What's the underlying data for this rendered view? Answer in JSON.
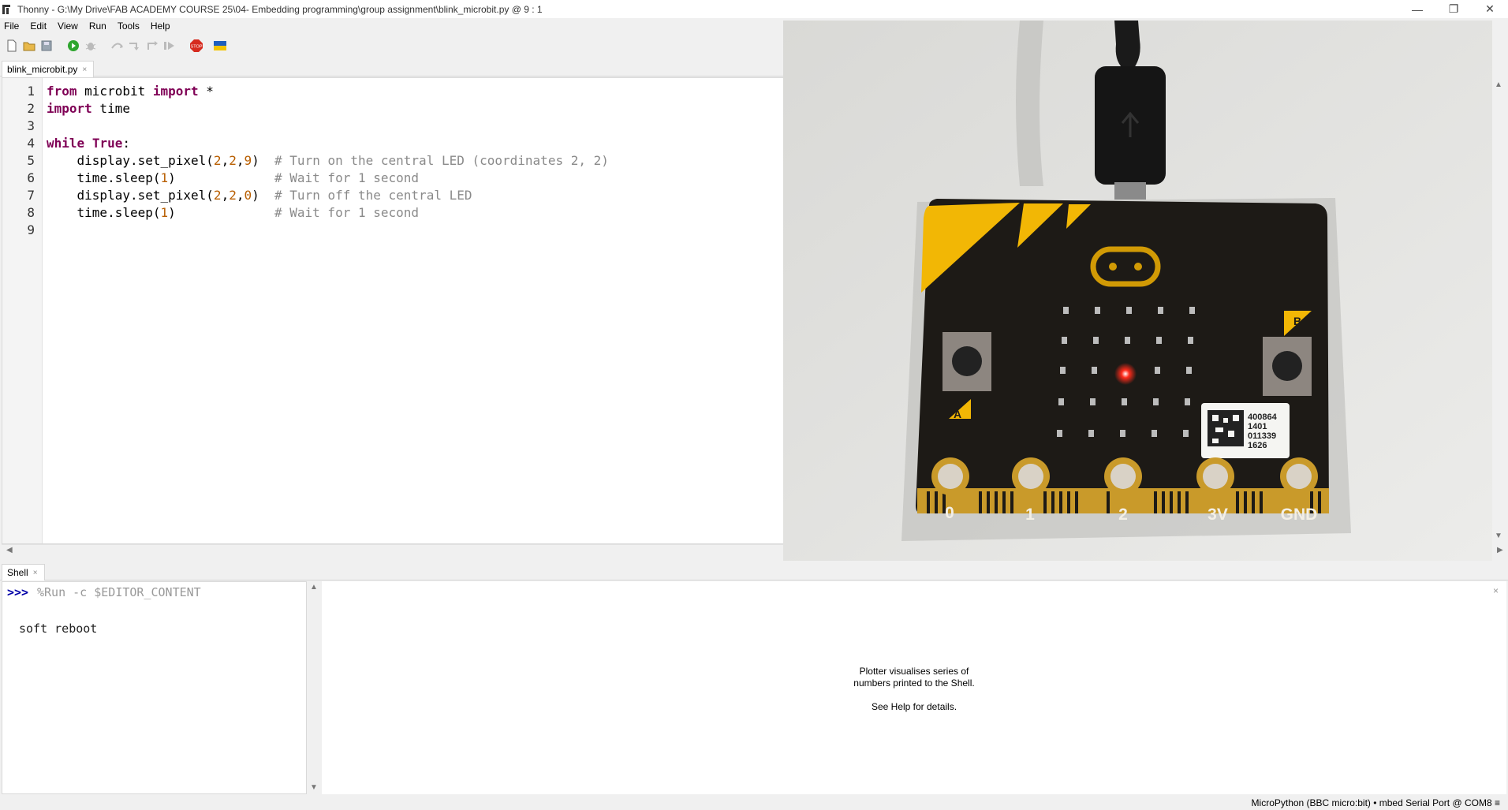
{
  "window": {
    "title": "Thonny  -  G:\\My Drive\\FAB ACADEMY COURSE 25\\04- Embedding programming\\group assignment\\blink_microbit.py  @  9 : 1",
    "minimize": "—",
    "maximize": "❐",
    "close": "✕"
  },
  "menu": [
    "File",
    "Edit",
    "View",
    "Run",
    "Tools",
    "Help"
  ],
  "toolbar": {
    "buttons": [
      "new-file-icon",
      "open-file-icon",
      "save-icon",
      "run-icon",
      "debug-icon",
      "step-over-icon",
      "step-into-icon",
      "step-out-icon",
      "resume-icon",
      "stop-icon",
      "ukraine-flag-icon"
    ],
    "stop_label": "STOP"
  },
  "editor": {
    "tab_label": "blink_microbit.py",
    "tab_close": "×",
    "line_numbers": [
      "1",
      "2",
      "3",
      "4",
      "5",
      "6",
      "7",
      "8",
      "9"
    ],
    "lines": [
      [
        "from",
        " microbit ",
        "import",
        " *"
      ],
      [
        "import",
        " time"
      ],
      [
        ""
      ],
      [
        "while",
        " ",
        "True",
        ":"
      ],
      [
        "    display.set_pixel(",
        "2",
        ",",
        "2",
        ",",
        "9",
        ")  ",
        "# Turn on the central LED (coordinates 2, 2)"
      ],
      [
        "    time.sleep(",
        "1",
        ")             ",
        "# Wait for 1 second"
      ],
      [
        "    display.set_pixel(",
        "2",
        ",",
        "2",
        ",",
        "0",
        ")  ",
        "# Turn off the central LED"
      ],
      [
        "    time.sleep(",
        "1",
        ")             ",
        "# Wait for 1 second"
      ],
      [
        ""
      ]
    ]
  },
  "photo": {
    "board_labels": [
      "0",
      "1",
      "2",
      "3V",
      "GND"
    ],
    "button_a": "A",
    "button_b": "B",
    "sticker_lines": [
      "400864",
      "1401",
      "011339",
      "1626"
    ]
  },
  "shell": {
    "tab_label": "Shell",
    "tab_close": "×",
    "prompt": ">>>",
    "command": "%Run -c $EDITOR_CONTENT",
    "output": "soft reboot"
  },
  "plotter": {
    "close": "×",
    "line1": "Plotter visualises series of",
    "line2": "numbers printed to the Shell.",
    "line3": "See Help for details."
  },
  "status": {
    "text": "MicroPython (BBC micro:bit)  •  mbed Serial Port @ COM8  ≡"
  },
  "colors": {
    "keyword": "#7f0055",
    "number": "#b85e00",
    "comment": "#8a8a8a",
    "prompt": "#0000a8",
    "led_on": "#ff2b1a",
    "board": "#1d1a16",
    "board_yellow": "#f2b705"
  }
}
